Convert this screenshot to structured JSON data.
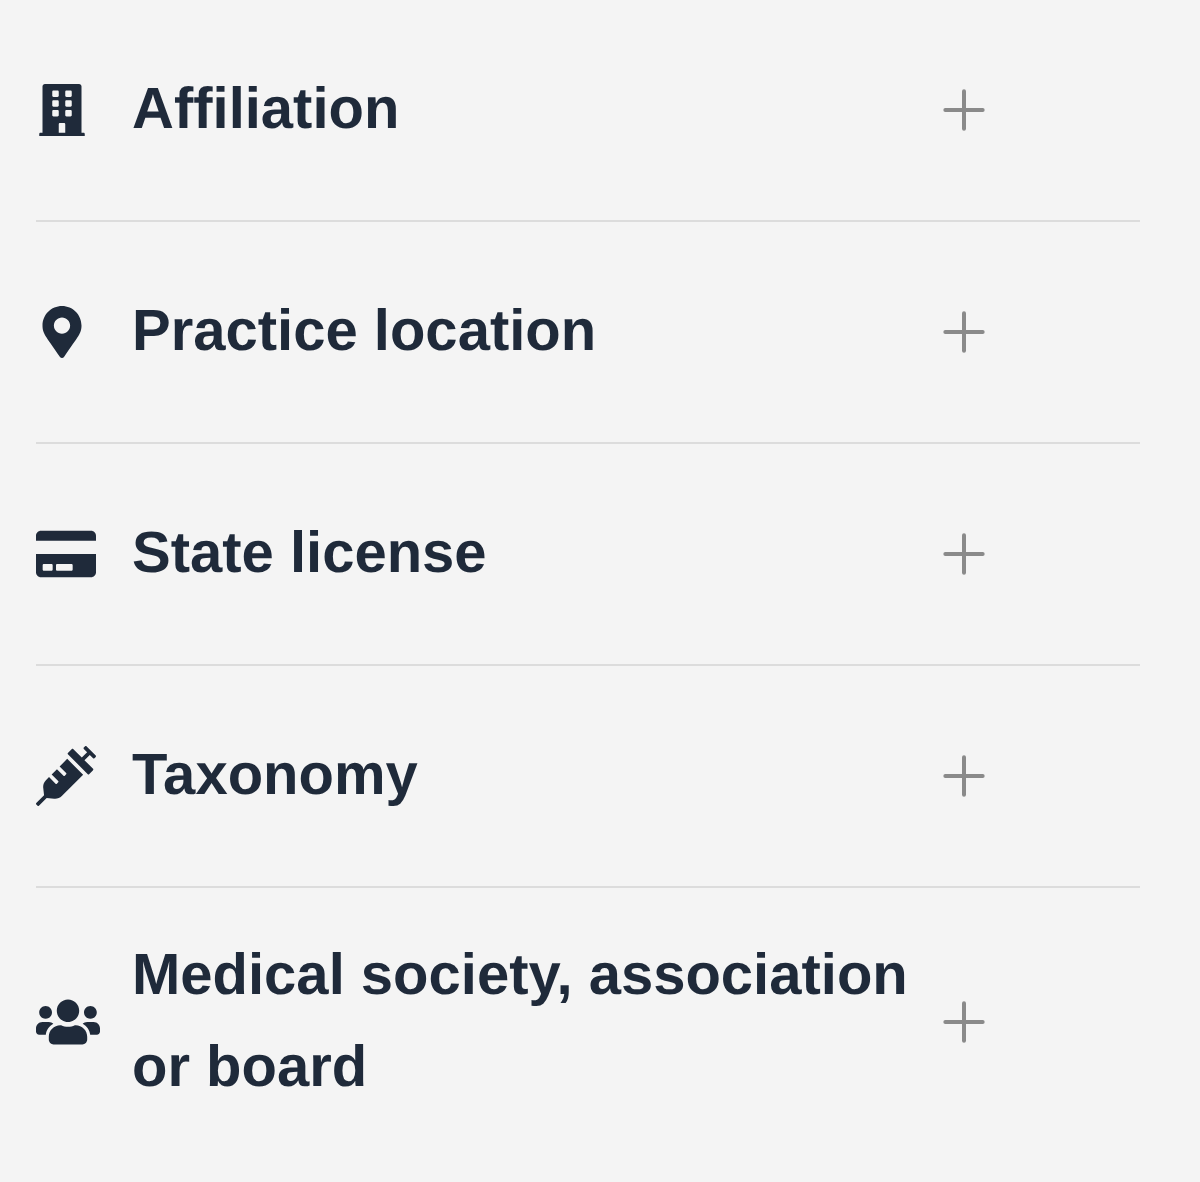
{
  "sections": [
    {
      "kind": "organization",
      "label": "Affiliation"
    },
    {
      "kind": "location",
      "label": "Practice location"
    },
    {
      "kind": "license",
      "label": "State license"
    },
    {
      "kind": "taxonomy",
      "label": "Taxonomy"
    },
    {
      "kind": "society",
      "label": "Medical society, association or board"
    }
  ]
}
